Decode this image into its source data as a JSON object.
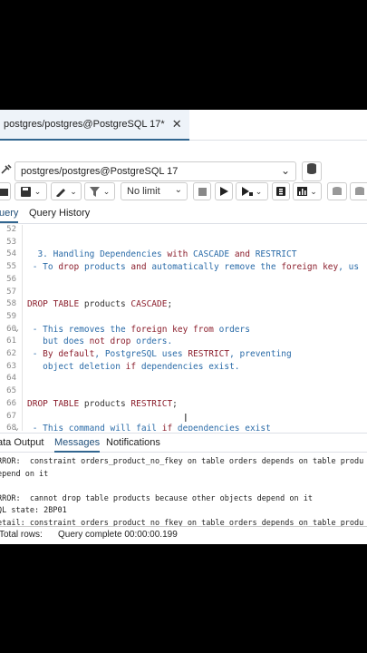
{
  "tab": {
    "title": "postgres/postgres@PostgreSQL 17*",
    "close": "✕"
  },
  "connection": {
    "value": "postgres/postgres@PostgreSQL 17",
    "chevron": "⌄"
  },
  "toolbar": {
    "limit": "No limit",
    "chevron": "⌄"
  },
  "query_tabs": [
    "uery",
    "Query History"
  ],
  "editor": {
    "lines": [
      {
        "n": "52",
        "parts": []
      },
      {
        "n": "53",
        "parts": []
      },
      {
        "n": "54",
        "parts": [
          {
            "c": "cm",
            "t": "  3. Handling Dependencies "
          },
          {
            "c": "kw",
            "t": "with"
          },
          {
            "c": "cm",
            "t": " CASCADE "
          },
          {
            "c": "kw",
            "t": "and"
          },
          {
            "c": "cm",
            "t": " RESTRICT"
          }
        ]
      },
      {
        "n": "55",
        "parts": [
          {
            "c": "cm",
            "t": " - To "
          },
          {
            "c": "kw",
            "t": "drop"
          },
          {
            "c": "cm",
            "t": " products "
          },
          {
            "c": "kw",
            "t": "and"
          },
          {
            "c": "cm",
            "t": " automatically remove the "
          },
          {
            "c": "kw",
            "t": "foreign key"
          },
          {
            "c": "cm",
            "t": ", us"
          }
        ]
      },
      {
        "n": "56",
        "parts": []
      },
      {
        "n": "57",
        "parts": []
      },
      {
        "n": "58",
        "parts": [
          {
            "c": "kw",
            "t": "DROP TABLE"
          },
          {
            "c": "id",
            "t": " products "
          },
          {
            "c": "kw",
            "t": "CASCADE"
          },
          {
            "c": "id",
            "t": ";"
          }
        ]
      },
      {
        "n": "59",
        "parts": []
      },
      {
        "n": "60",
        "fold": true,
        "parts": [
          {
            "c": "cm",
            "t": " - This removes the "
          },
          {
            "c": "kw",
            "t": "foreign key from"
          },
          {
            "c": "cm",
            "t": " orders"
          }
        ]
      },
      {
        "n": "61",
        "parts": [
          {
            "c": "cm",
            "t": "   but does "
          },
          {
            "c": "kw",
            "t": "not drop"
          },
          {
            "c": "cm",
            "t": " orders."
          }
        ]
      },
      {
        "n": "62",
        "parts": [
          {
            "c": "cm",
            "t": " - "
          },
          {
            "c": "kw",
            "t": "By default"
          },
          {
            "c": "cm",
            "t": ", PostgreSQL uses "
          },
          {
            "c": "kw",
            "t": "RESTRICT"
          },
          {
            "c": "cm",
            "t": ", preventing"
          }
        ]
      },
      {
        "n": "63",
        "parts": [
          {
            "c": "cm",
            "t": "   object deletion "
          },
          {
            "c": "kw",
            "t": "if"
          },
          {
            "c": "cm",
            "t": " dependencies exist."
          }
        ]
      },
      {
        "n": "64",
        "parts": []
      },
      {
        "n": "65",
        "parts": []
      },
      {
        "n": "66",
        "parts": [
          {
            "c": "kw",
            "t": "DROP TABLE"
          },
          {
            "c": "id",
            "t": " products "
          },
          {
            "c": "kw",
            "t": "RESTRICT"
          },
          {
            "c": "id",
            "t": ";"
          }
        ]
      },
      {
        "n": "67",
        "parts": []
      },
      {
        "n": "68",
        "fold": true,
        "parts": [
          {
            "c": "cm",
            "t": " - This command will fail "
          },
          {
            "c": "kw",
            "t": "if"
          },
          {
            "c": "cm",
            "t": " dependencies exist"
          }
        ]
      }
    ]
  },
  "result_tabs": [
    "ata Output",
    "Messages",
    "Notifications"
  ],
  "messages": [
    "RROR:  constraint orders_product_no_fkey on table orders depends on table produ",
    "epend on it",
    "",
    "RROR:  cannot drop table products because other objects depend on it",
    "QL state: 2BP01",
    "etail: constraint orders_product_no_fkey on table orders depends on table produ"
  ],
  "status": {
    "rows": "Total rows:",
    "query": "Query complete 00:00:00.199"
  }
}
